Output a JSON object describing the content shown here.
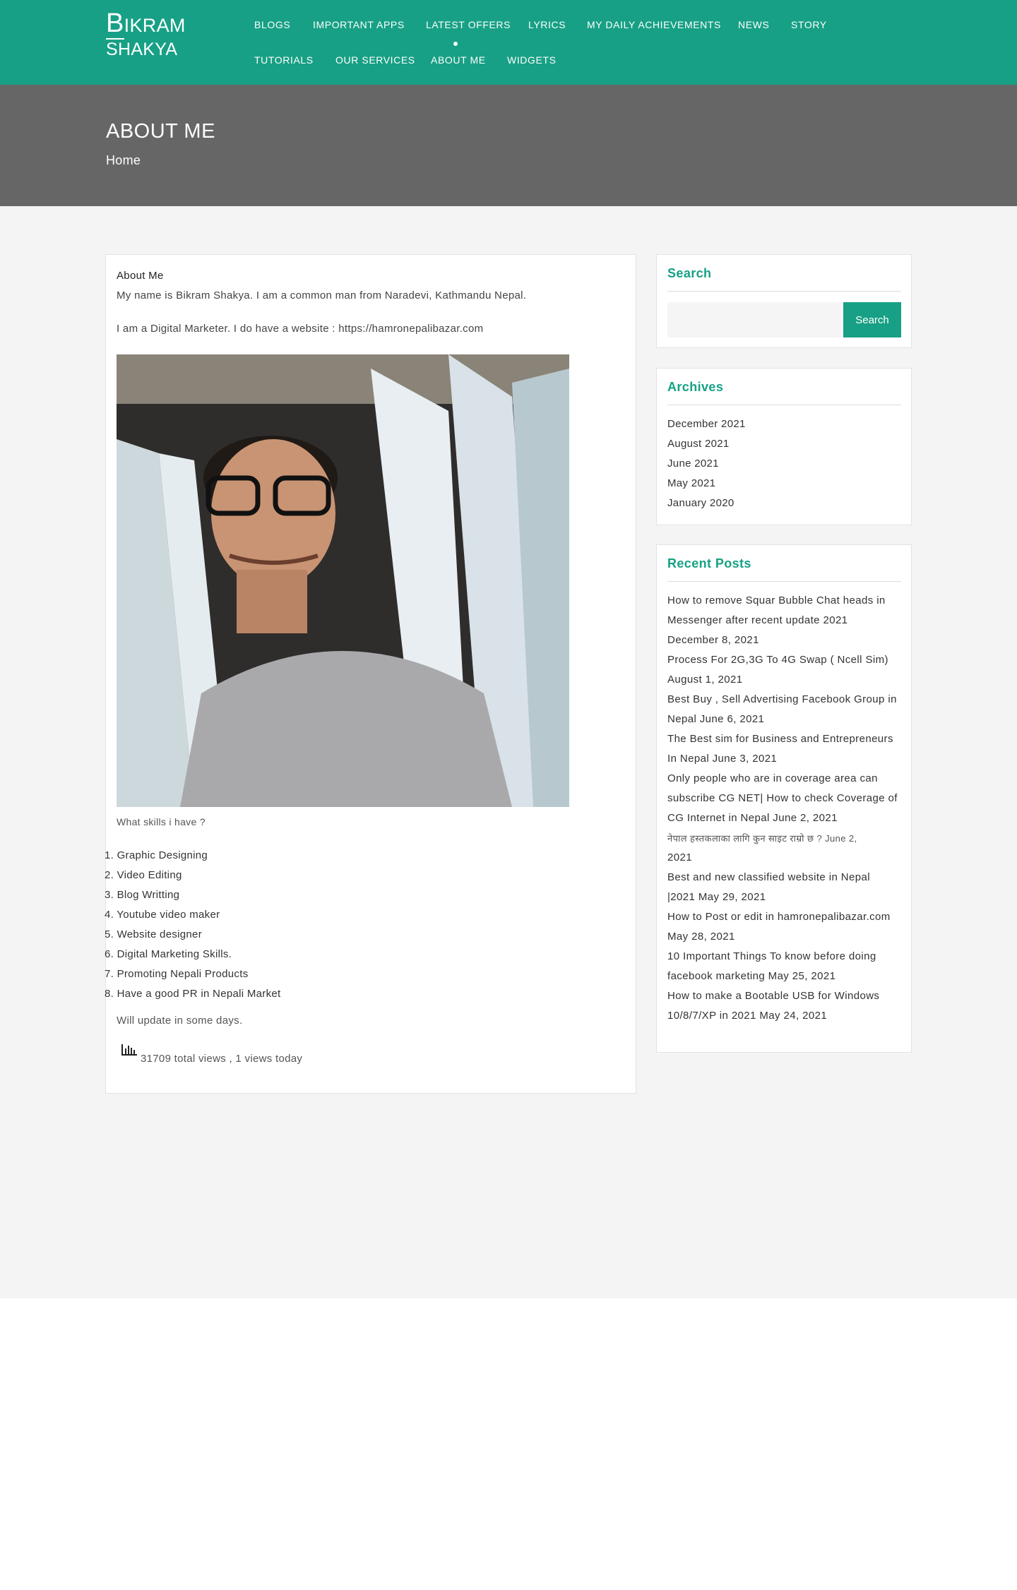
{
  "header": {
    "logo_line1_first": "B",
    "logo_line1_rest": "ikram",
    "logo_line2": "Shakya",
    "nav": [
      "Blogs",
      "Important Apps",
      "Latest Offers",
      "Lyrics",
      "My Daily Achievements",
      "News",
      "Story",
      "Tutorials",
      "Our Services",
      "About Me",
      "Widgets"
    ],
    "active_nav": "About Me"
  },
  "banner": {
    "title": "ABOUT ME",
    "breadcrumb": "Home"
  },
  "main": {
    "heading": "About Me",
    "intro": "My name is Bikram Shakya. I am a common man from Naradevi, Kathmandu Nepal.",
    "website_line": "I am a Digital Marketer. I do have a website : https://hamronepalibazar.com",
    "skills_question": "What skills i have ?",
    "skills": [
      "1. Graphic Designing",
      "2. Video Editing",
      "3. Blog Writting",
      "4. Youtube video maker",
      "5. Website designer",
      "6. Digital Marketing Skills.",
      "7. Promoting Nepali Products",
      "8. Have a good PR in Nepali Market"
    ],
    "update_note": "Will update in some days.",
    "views": "31709 total views , 1 views today"
  },
  "sidebar": {
    "search": {
      "title": "Search",
      "button": "Search"
    },
    "archives": {
      "title": "Archives",
      "items": [
        "December 2021",
        "August 2021",
        "June 2021",
        "May 2021",
        "January 2020"
      ]
    },
    "recent_posts": {
      "title": "Recent Posts",
      "lines": [
        "How to remove Squar Bubble Chat heads in",
        "Messenger after recent update 2021",
        "December 8, 2021",
        "Process For 2G,3G To 4G Swap ( Ncell Sim)",
        "August 1, 2021",
        "Best Buy , Sell Advertising Facebook Group in",
        "Nepal June 6, 2021",
        "The Best sim for Business and Entrepreneurs",
        "In Nepal June 3, 2021",
        "Only people who are in coverage area can",
        "subscribe CG NET| How to check Coverage of",
        "CG Internet in Nepal June 2, 2021",
        "नेपाल हस्तकलाका लागि कुन साइट राम्रो छ ? June 2,",
        "2021",
        "Best and new classified website in Nepal",
        "|2021 May 29, 2021",
        "How to Post or edit in hamronepalibazar.com",
        "May 28, 2021",
        "10 Important Things To know before doing",
        "facebook marketing May 25, 2021",
        "How to make a Bootable USB for Windows",
        "10/8/7/XP in 2021 May 24, 2021"
      ]
    }
  },
  "colors": {
    "brand": "#17a085",
    "banner": "#666666",
    "content_bg": "#f4f4f4"
  }
}
